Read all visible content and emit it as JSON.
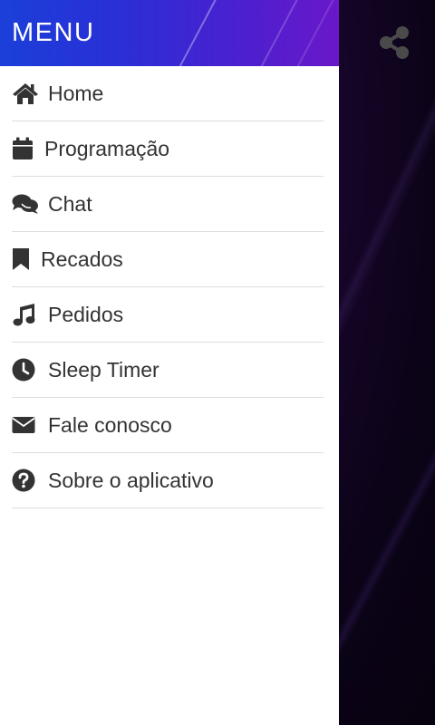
{
  "header": {
    "title": "MENU"
  },
  "toolbar": {
    "share_icon": "share-icon"
  },
  "menu": {
    "items": [
      {
        "label": "Home",
        "icon": "home-icon"
      },
      {
        "label": "Programação",
        "icon": "calendar-icon"
      },
      {
        "label": "Chat",
        "icon": "comments-icon"
      },
      {
        "label": "Recados",
        "icon": "bookmark-icon"
      },
      {
        "label": "Pedidos",
        "icon": "music-icon"
      },
      {
        "label": "Sleep Timer",
        "icon": "clock-icon"
      },
      {
        "label": "Fale conosco",
        "icon": "envelope-icon"
      },
      {
        "label": "Sobre o aplicativo",
        "icon": "question-circle-icon"
      }
    ]
  },
  "colors": {
    "header_gradient_start": "#1b3fd9",
    "header_gradient_end": "#6a18c9",
    "text": "#333333",
    "divider": "#dddddd",
    "background_dark": "#0d0417"
  }
}
